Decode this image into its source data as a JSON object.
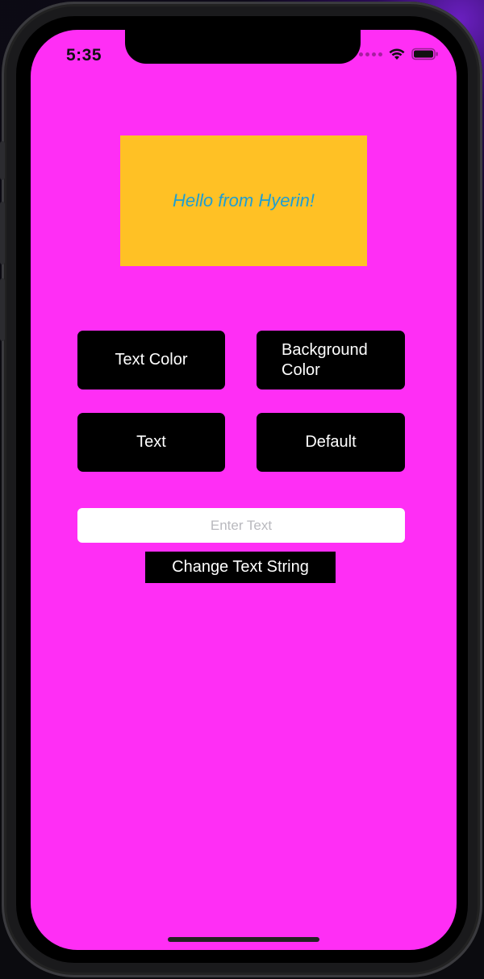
{
  "colors": {
    "screen_background": "#ff2ef5",
    "label_background": "#ffc125",
    "label_text": "#1f9ed1",
    "button_background": "#000000",
    "button_text": "#ffffff"
  },
  "status_bar": {
    "time": "5:35"
  },
  "label": {
    "text": "Hello from Hyerin!"
  },
  "buttons": {
    "text_color": "Text Color",
    "background_color": "Background\nColor",
    "text": "Text",
    "default": "Default"
  },
  "input": {
    "value": "",
    "placeholder": "Enter Text"
  },
  "change_text_button": {
    "label": "Change Text String"
  }
}
